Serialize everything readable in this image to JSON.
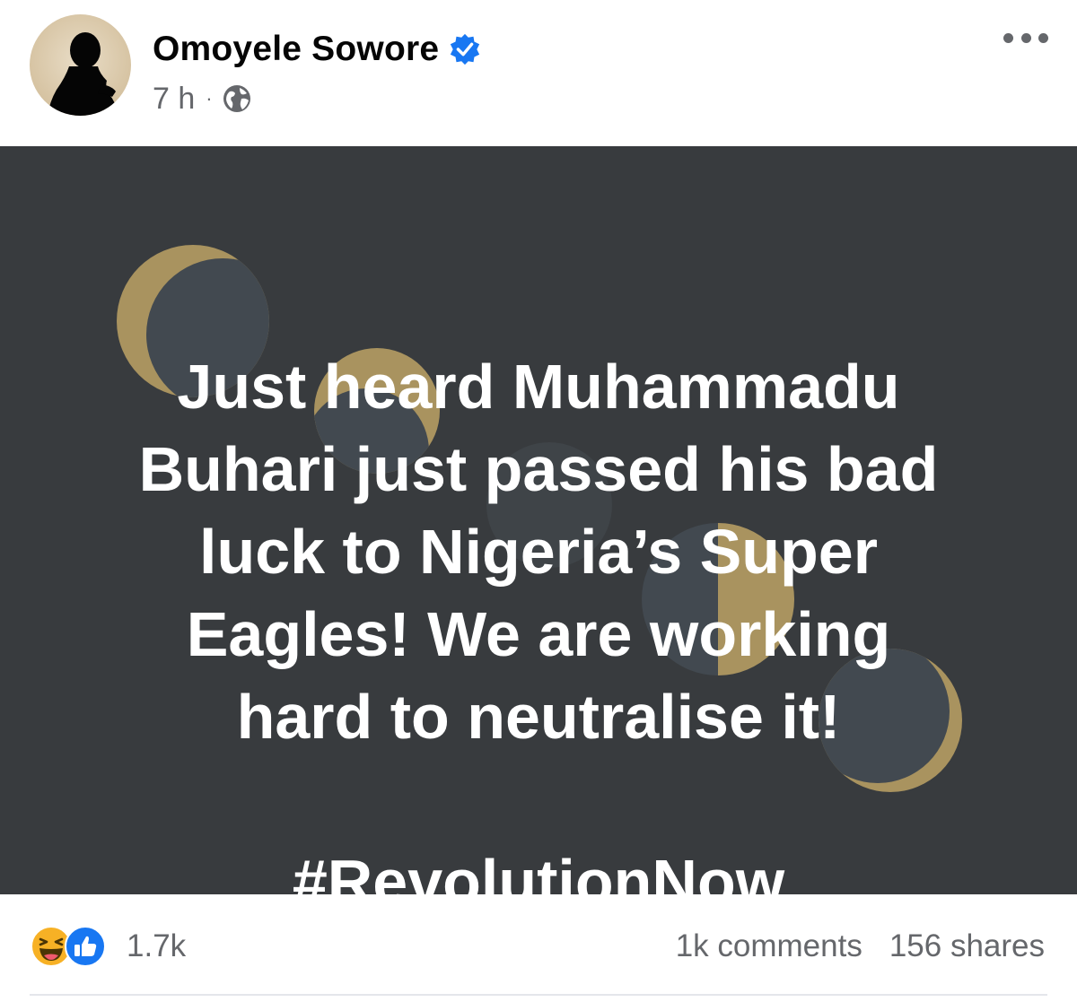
{
  "post": {
    "author": "Omoyele Sowore",
    "time": "7 h",
    "separator": "·",
    "verified_icon": "verified-badge-icon",
    "privacy_icon": "globe-icon",
    "more_icon": "more-options-icon",
    "text_lines": "Just heard Muhammadu\nBuhari just passed his bad\nluck to Nigeria’s Super\nEagles! We are working\nhard to neutralise it!",
    "hashtag": "#RevolutionNow",
    "background_color": "#383b3e",
    "accent_color": "#a9935f"
  },
  "footer": {
    "reaction_icons": [
      "haha-icon",
      "like-icon"
    ],
    "reaction_count": "1.7k",
    "comments": "1k comments",
    "shares": "156 shares"
  }
}
